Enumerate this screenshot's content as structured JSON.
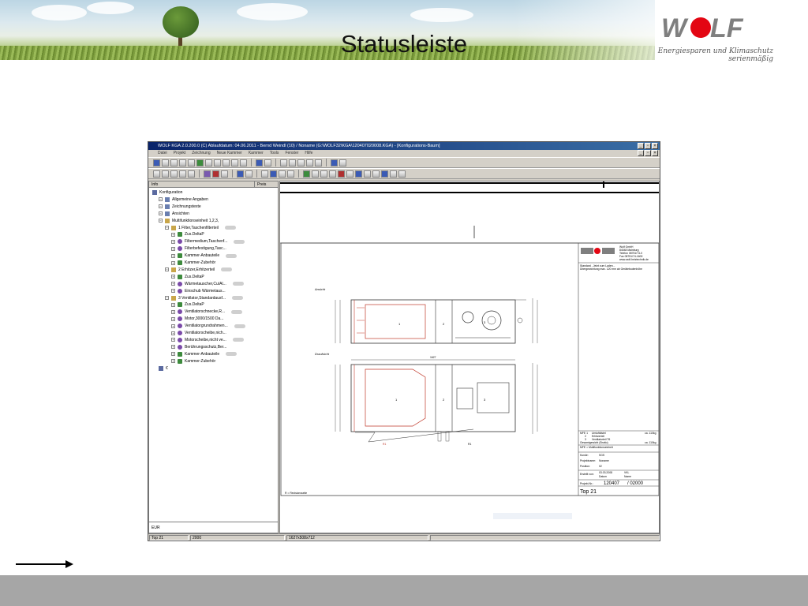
{
  "slide": {
    "title": "Statusleiste",
    "logo": {
      "word": "WOLF",
      "tagline": "Energiesparen und Klimaschutz serienmäßig",
      "colors": {
        "gray": "#7f7f7f",
        "red": "#e30613"
      }
    }
  },
  "app": {
    "title": "WOLF KGA 2.0.200.0 (C) Ablaufdatum: 04.06.2011 - Bernd Weindl (10) / Noname (G:\\WOLF32\\KGA\\120407020008.KGA) - [Konfigurations-Baum]",
    "menu": [
      "Datei",
      "Projekt",
      "Zeichnung",
      "Neue Kammer",
      "Kammer",
      "Tools",
      "Fenster",
      "Hilfe"
    ],
    "tree": {
      "headers": {
        "info": "Info",
        "preis": "Preis"
      },
      "items": [
        {
          "label": "Konfiguration",
          "level": 0,
          "icon": "gear-icon"
        },
        {
          "label": "Allgemeine Angaben",
          "level": 1,
          "icon": "document-icon"
        },
        {
          "label": "Zeichnungstexte",
          "level": 1,
          "icon": "document-icon"
        },
        {
          "label": "Ansichten",
          "level": 1,
          "icon": "view-icon"
        },
        {
          "label": "Multifunktionseinheit 1,2,3,",
          "level": 1,
          "icon": "unit-icon"
        },
        {
          "label": "1 Filter,Taschenfilterteil",
          "level": 2,
          "icon": "chamber-icon"
        },
        {
          "label": "Zus.DeltaP",
          "level": 3,
          "icon": "component-icon"
        },
        {
          "label": "Filtermedium,Taschenf...",
          "level": 3,
          "icon": "filter-icon"
        },
        {
          "label": "Filterbefestigung,Tasc...",
          "level": 3,
          "icon": "filter-icon"
        },
        {
          "label": "Kammer-Anbauteile",
          "level": 3,
          "icon": "parts-icon"
        },
        {
          "label": "Kammer-Zubehör",
          "level": 3,
          "icon": "parts-icon"
        },
        {
          "label": "2 Erhitzer,Erhitzerteil",
          "level": 2,
          "icon": "chamber-icon"
        },
        {
          "label": "Zus.DeltaP",
          "level": 3,
          "icon": "component-icon"
        },
        {
          "label": "Wärmetauscher,Cu/Al...",
          "level": 3,
          "icon": "heat-exchanger-icon"
        },
        {
          "label": "Einschub Wärmetaus...",
          "level": 3,
          "icon": "heat-exchanger-icon"
        },
        {
          "label": "3 Ventilator,Standardausf...",
          "level": 2,
          "icon": "chamber-icon"
        },
        {
          "label": "Zus.DeltaP",
          "level": 3,
          "icon": "component-icon"
        },
        {
          "label": "Ventilatorschnecke,R...",
          "level": 3,
          "icon": "fan-icon"
        },
        {
          "label": "Motor,3000/1500 Da...",
          "level": 3,
          "icon": "motor-icon"
        },
        {
          "label": "Ventilatorgrundrahmen...",
          "level": 3,
          "icon": "fan-icon"
        },
        {
          "label": "Ventilatorscheibe,nich...",
          "level": 3,
          "icon": "fan-icon"
        },
        {
          "label": "Motorscheibe,nicht ve...",
          "level": 3,
          "icon": "motor-icon"
        },
        {
          "label": "Berührungsschutz,Ber...",
          "level": 3,
          "icon": "fan-icon"
        },
        {
          "label": "Kammer-Anbauteile",
          "level": 3,
          "icon": "parts-icon"
        },
        {
          "label": "Kammer-Zubehör",
          "level": 3,
          "icon": "parts-icon"
        },
        {
          "label": "€",
          "level": 1,
          "icon": "euro-icon"
        }
      ],
      "footer": "EUR"
    },
    "drawing": {
      "ansicht_label": "Ansicht",
      "draufsicht_label": "Draufsicht",
      "dimension": "1627",
      "sections": [
        "1",
        "2",
        "3"
      ],
      "r_labels": [
        "R1",
        "R1"
      ],
      "note": "R = Revisionsseite",
      "titleblock": {
        "company": "Wolf GmbH",
        "city": "84048 Mainburg",
        "phone": "Telefon 08751/74-0",
        "fax": "Fax 08751/74-1600",
        "web": "www.wolf-heiztechnik.de",
        "desc1": "Standard - Jetzt zum Laden...",
        "desc2": "Übergewichtung max. 120 mm ab Gerätebodenhöhe",
        "parts": [
          {
            "nr": "MFE 1",
            "name": "Umluftdistel",
            "weight": "ca. 110kg"
          },
          {
            "nr": "2",
            "name": "Erhitzerteil",
            "weight": ""
          },
          {
            "nr": "3",
            "name": "Ventilatorteil T6",
            "weight": ""
          }
        ],
        "gesamt": "Gesamtgewicht (Brutto)",
        "gesamt_value": "ca. 110kg",
        "mfe_line": "MFE = Multifunktionseinheit",
        "kunde_label": "Kunde:",
        "kunde": "SGS",
        "projekt_label": "Projektname:",
        "projekt": "Noname",
        "position_label": "Position:",
        "position": "02",
        "datum_label": "Erstellt von:",
        "datum": "03.03.2008",
        "datum_status": "VKL",
        "datum_sub": "Datum",
        "name_sub": "Name",
        "projektnr_label": "Projekt-Nr.:",
        "projektnr": "120407",
        "projektnr_suffix": "/ 02000",
        "top": "Top 21"
      }
    },
    "status": {
      "field1": "Top 21",
      "field2": "2000",
      "field3": "",
      "field4": "1627x508x712"
    }
  },
  "colors": {
    "drawing_red": "#c0392b",
    "drawing_line": "#333333",
    "window_titlebar": "#0a246a",
    "window_face": "#d4d0c8",
    "footer_bar": "#a6a6a6"
  }
}
